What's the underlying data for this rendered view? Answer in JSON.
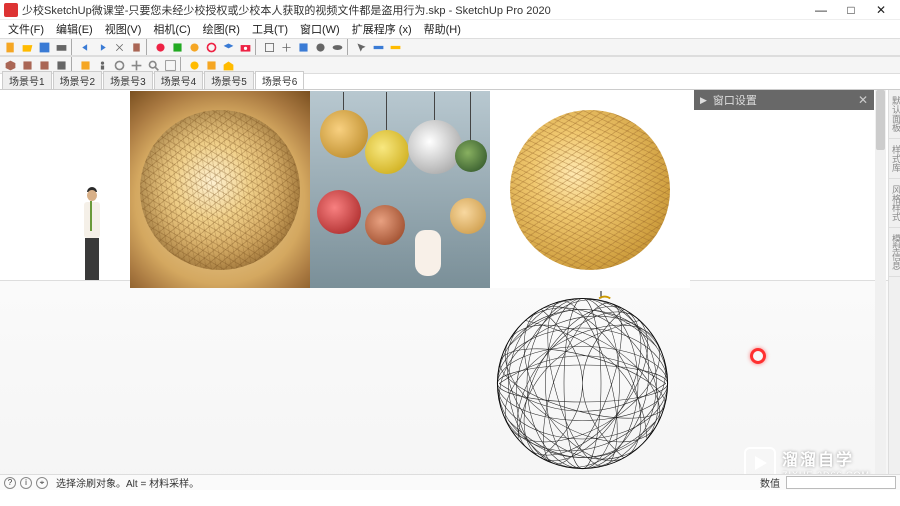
{
  "titlebar": {
    "title": "少校SketchUp微课堂-只要您未经少校授权或少校本人获取的视频文件都是盗用行为.skp - SketchUp Pro 2020"
  },
  "menu": {
    "items": [
      "文件(F)",
      "编辑(E)",
      "视图(V)",
      "相机(C)",
      "绘图(R)",
      "工具(T)",
      "窗口(W)",
      "扩展程序 (x)",
      "帮助(H)"
    ]
  },
  "scene_tabs": {
    "items": [
      "场景号1",
      "场景号2",
      "场景号3",
      "场景号4",
      "场景号5",
      "场景号6"
    ],
    "active_index": 5
  },
  "tray": {
    "title": "窗口设置"
  },
  "right_tabs": {
    "items": [
      "默认面板",
      "样式库",
      "风格样式",
      "模型信息"
    ]
  },
  "statusbar": {
    "hint": "选择涂刷对象。Alt = 材料采样。",
    "measure_label": "数值"
  },
  "watermark": {
    "main": "溜溜自学",
    "sub": "ZIXUE.3D66.COM"
  },
  "window_controls": {
    "min": "—",
    "max": "□",
    "close": "✕"
  }
}
